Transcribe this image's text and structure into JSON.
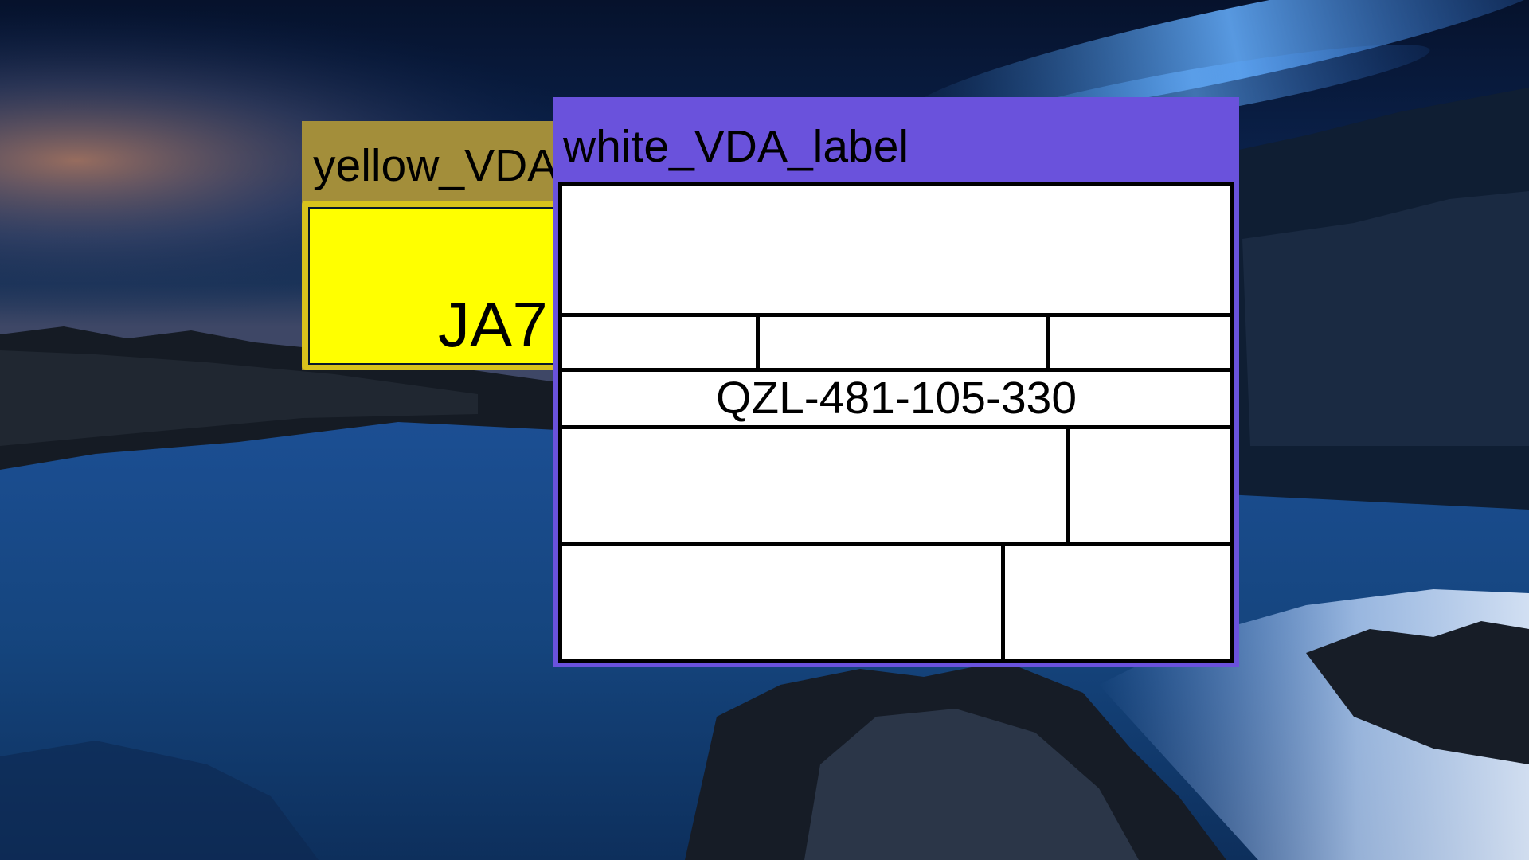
{
  "desktop": {
    "wallpaper": "coastal-night-landscape"
  },
  "yellow_window": {
    "title": "yellow_VDA_label",
    "code_visible": "JA7",
    "colors": {
      "frame": "#a38e3a",
      "body": "#ffff00"
    }
  },
  "white_window": {
    "title": "white_VDA_label",
    "tracking_number": "QZL-481-105-330",
    "colors": {
      "frame": "#6a52dc",
      "body": "#ffffff"
    }
  }
}
